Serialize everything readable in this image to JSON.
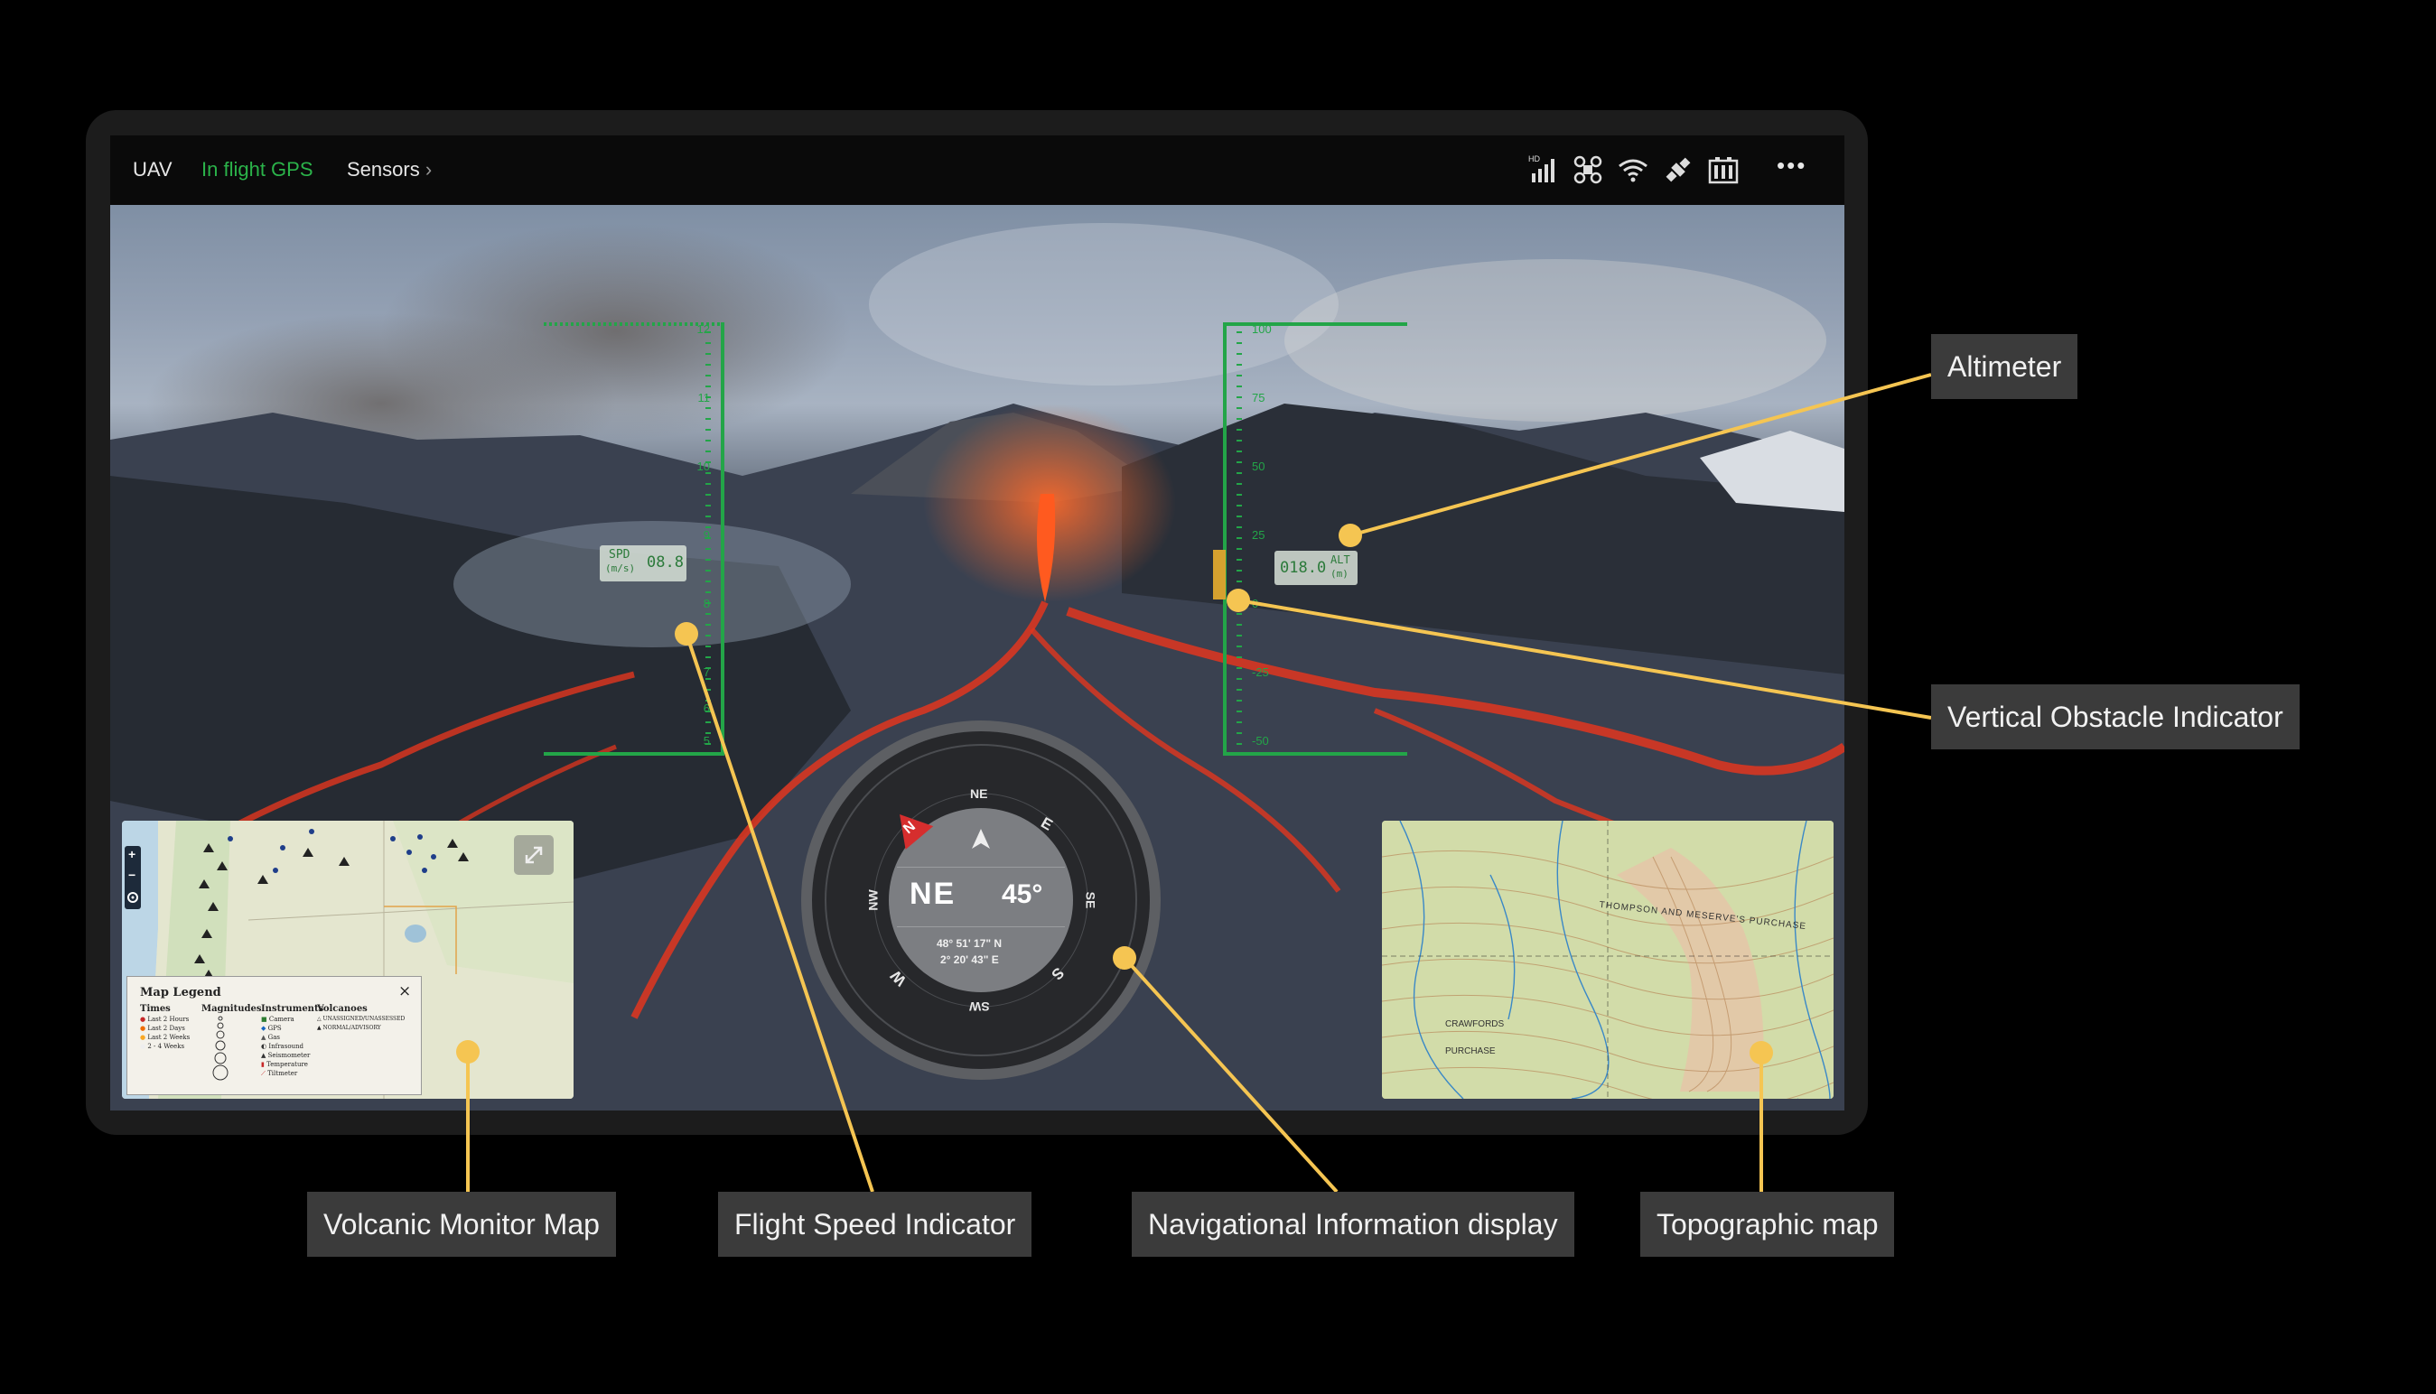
{
  "topbar": {
    "tab_uav": "UAV",
    "tab_gps": "In flight GPS",
    "tab_sensors": "Sensors",
    "sensors_chevron": "›",
    "more_icon_glyph": "•••",
    "hd_badge": "HD",
    "gps_color": "#2bb34a"
  },
  "speed_indicator": {
    "ticks": [
      "12",
      "11",
      "10",
      "9",
      "8",
      "7",
      "6",
      "5"
    ],
    "label": "SPD",
    "unit": "(m/s)",
    "value": "08.8"
  },
  "altimeter": {
    "ticks": [
      "100",
      "75",
      "50",
      "25",
      "0",
      "-25",
      "-50"
    ],
    "label": "ALT",
    "unit": "(m)",
    "value": "018.0",
    "obstacle_fill_percent": 55
  },
  "compass": {
    "direction": "NE",
    "heading": "45°",
    "lat": "48° 51' 17\" N",
    "lon": "2° 20' 43\" E",
    "ring_labels": [
      "NE",
      "E",
      "SE",
      "S",
      "SW",
      "W",
      "NW"
    ],
    "north_marker": "N"
  },
  "volcanic_map": {
    "legend_title": "Map Legend",
    "legend_close": "×",
    "col_times": "Times",
    "col_magnitudes": "Magnitudes",
    "col_instruments": "Instruments",
    "col_volcanoes": "Volcanoes",
    "times": [
      "Last 2 Hours",
      "Last 2 Days",
      "Last 2 Weeks",
      "2 - 4 Weeks"
    ],
    "instruments": [
      "Camera",
      "GPS",
      "Gas",
      "Infrasound",
      "Seismometer",
      "Temperature",
      "Tiltmeter"
    ],
    "volcanoes": [
      "UNASSIGNED/UNASSESSED",
      "NORMAL/ADVISORY"
    ],
    "zoom_in": "+",
    "zoom_out": "−"
  },
  "topo_map": {
    "place_labels": [
      "THOMPSON AND MESERVE'S PURCHASE",
      "CRAWFORDS",
      "PURCHASE"
    ]
  },
  "callouts": {
    "altimeter": "Altimeter",
    "vertical_obstacle": "Vertical Obstacle Indicator",
    "volcanic_map": "Volcanic Monitor Map",
    "flight_speed": "Flight Speed Indicator",
    "nav_display": "Navigational Information display",
    "topo_map": "Topographic map"
  },
  "colors": {
    "hud_green": "#23a548",
    "callout_dot": "#f5c552",
    "callout_bg": "#3b3b3b",
    "lava": "#e2361e",
    "obstacle_bar": "#d6a12f"
  }
}
